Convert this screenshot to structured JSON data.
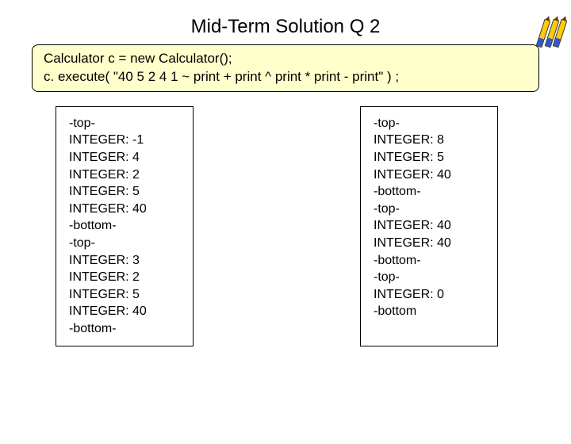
{
  "title": "Mid-Term Solution Q 2",
  "code": {
    "line1": "Calculator c = new Calculator();",
    "line2": "c. execute( \"40 5 2 4 1 ~ print + print ^ print * print - print\" ) ;"
  },
  "output_left": "-top-\nINTEGER: -1\nINTEGER: 4\nINTEGER: 2\nINTEGER: 5\nINTEGER: 40\n-bottom-\n-top-\nINTEGER: 3\nINTEGER: 2\nINTEGER: 5\nINTEGER: 40\n-bottom-",
  "output_right": "-top-\nINTEGER: 8\nINTEGER: 5\nINTEGER: 40\n-bottom-\n-top-\nINTEGER: 40\nINTEGER: 40\n-bottom-\n-top-\nINTEGER: 0\n-bottom"
}
